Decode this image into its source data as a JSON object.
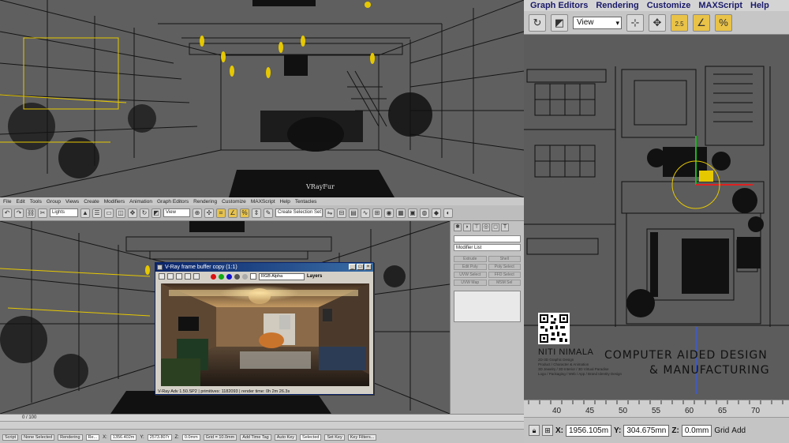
{
  "right_panel": {
    "menu": [
      "Graph Editors",
      "Rendering",
      "Customize",
      "MAXScript",
      "Help"
    ],
    "toolbar": {
      "view_select": "View",
      "icons": [
        "undo-icon",
        "redo-icon",
        "select-move-icon",
        "snap-2-5-icon",
        "angle-snap-icon",
        "percent-snap-icon"
      ],
      "snap_label": "2.5",
      "percent_label": "%"
    },
    "ruler_ticks": [
      "40",
      "45",
      "50",
      "55",
      "60",
      "65",
      "70"
    ],
    "coords": {
      "x_label": "X:",
      "x_value": "1956.105m",
      "y_label": "Y:",
      "y_value": "304.675mn",
      "z_label": "Z:",
      "z_value": "0.0mm",
      "grid_label": "Grid",
      "add_label": "Add"
    }
  },
  "brand": {
    "name": "NITI NIMALA",
    "sub_lines": [
      "2D-3D Graphic Design",
      "Product / Character & Animation",
      "3D Jewelry / 3D Interior / 3D Virtual Paradise",
      "Logo / Packaging / Web / App / Brand Identity Design"
    ],
    "tagline_1": "COMPUTER AIDED DESIGN",
    "tagline_2": "& MANUFACTURING"
  },
  "top_viewport": {
    "caption": "VRayFur"
  },
  "small_menu": [
    "File",
    "Edit",
    "Tools",
    "Group",
    "Views",
    "Create",
    "Modifiers",
    "Animation",
    "Graph Editors",
    "Rendering",
    "Customize",
    "MAXScript",
    "Help",
    "Tentacles"
  ],
  "small_toolbar": {
    "filter_select": "Lights",
    "view_select": "View",
    "selection_set": "Create Selection Set"
  },
  "command_panel": {
    "modifier_list": "Modifier List",
    "buttons": [
      "Extrude",
      "Shell",
      "Edit Poly",
      "Poly Select",
      "UVW Select",
      "FFD Select",
      "UVW Map",
      "MSM Sel"
    ]
  },
  "vray_window": {
    "title": "V-Ray frame buffer copy (1:1)",
    "channel": "RGB Alpha",
    "layers": "Layers",
    "status": "V-Ray Adv 1.50.SP2 | primitives: 1182093 | render time: 0h 2m 26.3s"
  },
  "status_bar": {
    "time": "0 / 100",
    "selection": "None Selected",
    "x_value": "1356.402m",
    "y_value": "2573.807r",
    "z_value": "0.0mm",
    "grid": "Grid = 10.0mm",
    "auto_key": "Auto Key",
    "key_mode": "Selected",
    "set_key": "Set Key",
    "key_filters": "Key Filters...",
    "add_time_tag": "Add Time Tag",
    "script": "Script",
    "render_tab": "Rendering",
    "prompt": "Re..."
  },
  "colors": {
    "viewport_gray": "#5f5f5f",
    "wire_black": "#111111",
    "selected_yellow": "#e6c800",
    "menu_text_blue": "#1a1a6a",
    "titlebar_blue": "#0a246a"
  }
}
